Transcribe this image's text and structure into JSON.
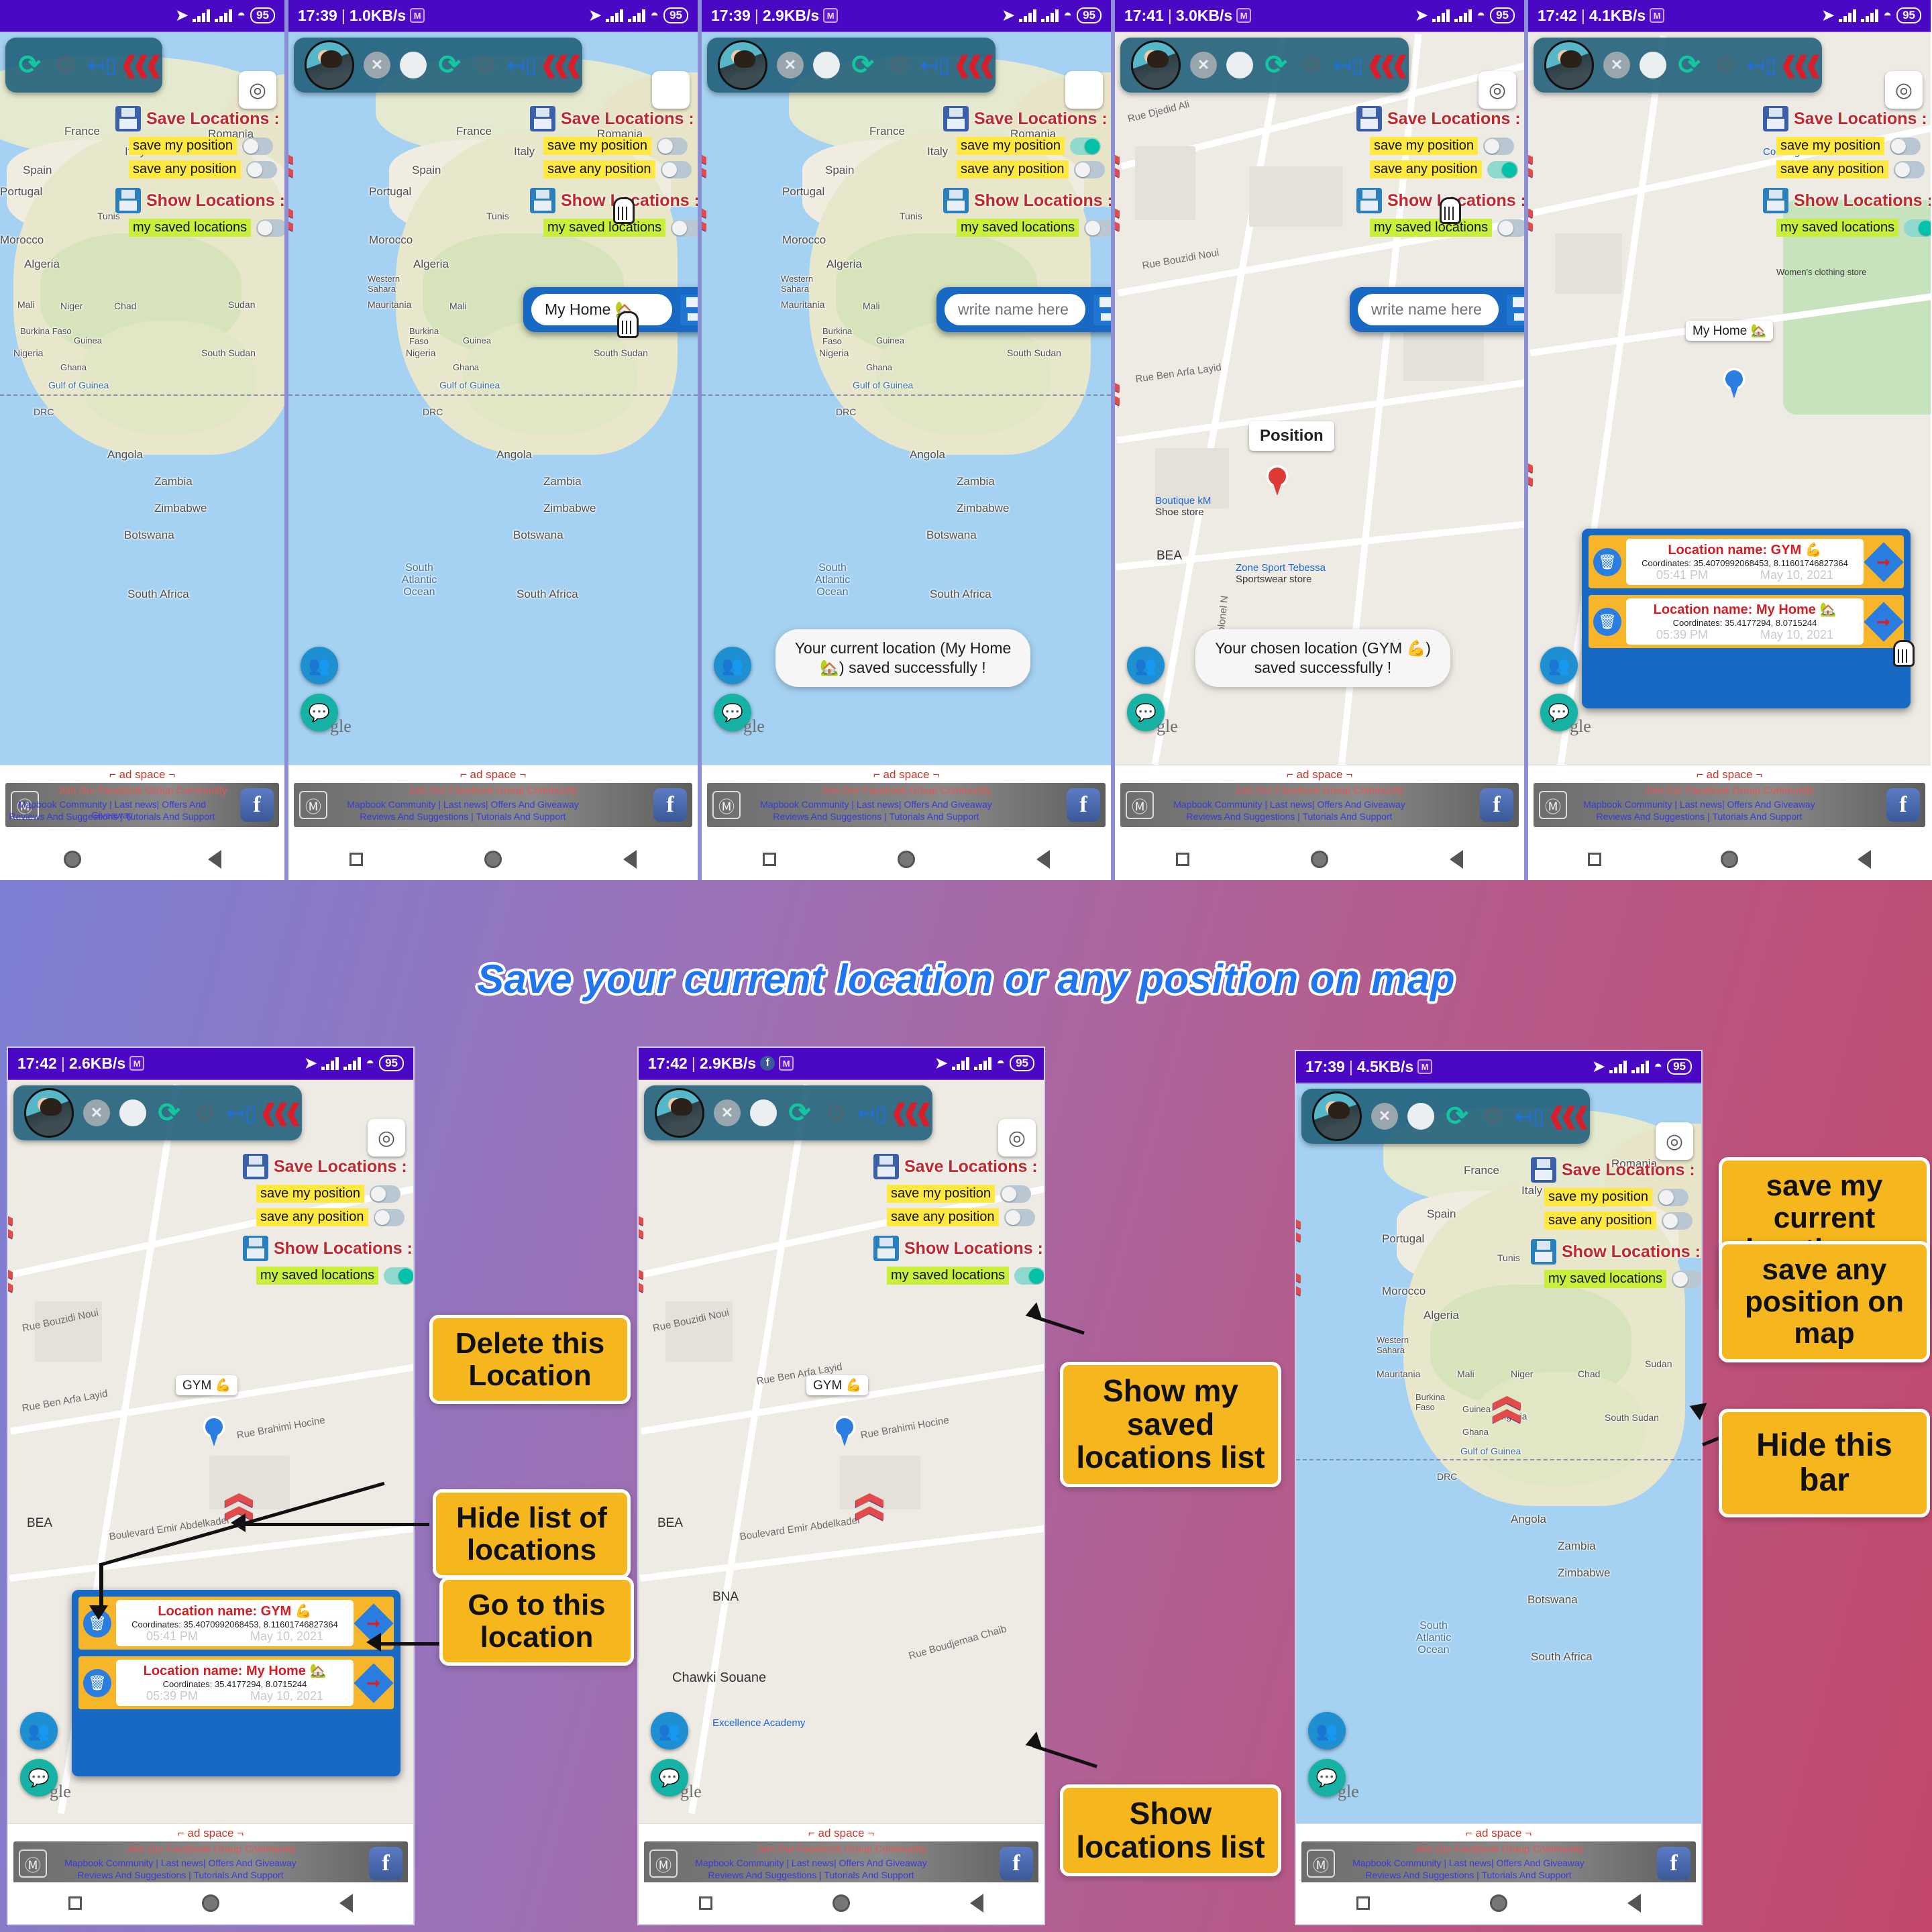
{
  "app": {
    "headline": "Save your current location or any position on map",
    "save_locations_label": "Save Locations :",
    "show_locations_label": "Show Locations :",
    "save_my_position": "save my position",
    "save_any_position": "save any position",
    "my_saved_locations": "my saved locations",
    "name_placeholder": "write name here",
    "name_value_my_home": "My Home 🏡",
    "gym_pin_label": "GYM 💪",
    "home_pin_label": "My Home 🏡",
    "position_pin_label": "Position"
  },
  "statusbars": [
    {
      "time": "",
      "speed": "",
      "battery": "95"
    },
    {
      "time": "17:39",
      "speed": "1.0KB/s",
      "battery": "95"
    },
    {
      "time": "17:39",
      "speed": "2.9KB/s",
      "battery": "95"
    },
    {
      "time": "17:41",
      "speed": "3.0KB/s",
      "battery": "95"
    },
    {
      "time": "17:42",
      "speed": "4.1KB/s",
      "battery": "95"
    },
    {
      "time": "17:42",
      "speed": "2.6KB/s",
      "battery": "95"
    },
    {
      "time": "17:42",
      "speed": "2.9KB/s",
      "battery": "95"
    },
    {
      "time": "17:39",
      "speed": "4.5KB/s",
      "battery": "95"
    }
  ],
  "toasts": {
    "current_saved": "Your current location (My Home 🏡) saved successfully !",
    "chosen_saved": "Your chosen location (GYM 💪) saved successfully !"
  },
  "saved_locations": [
    {
      "name": "Location name: GYM 💪",
      "coordinates": "Coordinates: 35.4070992068453, 8.11601746827364",
      "time": "05:41 PM",
      "date": "May 10, 2021"
    },
    {
      "name": "Location name: My Home 🏡",
      "coordinates": "Coordinates: 35.4177294, 8.0715244",
      "time": "05:39 PM",
      "date": "May 10, 2021"
    }
  ],
  "callouts": {
    "delete": "Delete this Location",
    "hide_list": "Hide list of locations",
    "go_to": "Go to this location",
    "show_my_saved": "Show my saved locations list",
    "show_list": "Show locations list",
    "save_current": "save my current location on map",
    "save_any": "save any position on map",
    "hide_bar": "Hide this bar"
  },
  "ad": {
    "ad_space": "⌐ ad space ¬",
    "line1": "Join Our Facebook Group Community",
    "line2": "Mapbook Community | Last news| Offers And Giveaway",
    "line3": "Reviews And Suggestions | Tutorials And Support",
    "facebook_icon": "f",
    "mapbook_icon": "Ⓜ"
  },
  "world_map_labels": [
    "France",
    "Romania",
    "Italy",
    "Spain",
    "Portugal",
    "Tunis",
    "Morocco",
    "Algeria",
    "Western Sahara",
    "Mauritania",
    "Mali",
    "Niger",
    "Chad",
    "Sudan",
    "Burkina Faso",
    "Guinea",
    "Nigeria",
    "Ghana",
    "South Sudan",
    "Gulf of Guinea",
    "Gabon",
    "DRC",
    "Angola",
    "Zambia",
    "Zimbabwe",
    "Botswana",
    "South Africa",
    "South Atlantic Ocean"
  ],
  "street_map_labels": [
    "Rue Djedid Ali",
    "Rue Bouzidi Noui",
    "Rue Ben Arfa Layid",
    "Rue Colonel N",
    "Rue Brahimi Hocine",
    "Boulevard Emir Abdelkader",
    "Rue Boudjemaa Chaib",
    "Chawki Souane",
    "Academy",
    "BEA",
    "BNA"
  ],
  "street_pois": [
    {
      "title": "Boutique kM",
      "sub": "Shoe store"
    },
    {
      "title": "Zone Sport Tebessa",
      "sub": "Sportswear store"
    },
    {
      "title": "Cooking and Food",
      "sub": ""
    },
    {
      "title": "Women's clothing store",
      "sub": ""
    },
    {
      "title": "Excellence Academy",
      "sub": ""
    }
  ],
  "icons": {
    "refresh": "refresh-icon",
    "gear": "gear-icon",
    "exit": "exit-icon",
    "chevrons": "double-chevron-icon",
    "gps": "gps-target-icon",
    "close": "close-icon",
    "floppy": "floppy-save-icon",
    "trash": "trash-icon",
    "navigate": "navigate-arrow-icon",
    "people": "people-icon",
    "chat": "chat-icon"
  },
  "colors": {
    "statusbar": "#4B08C4",
    "accent_red": "#c0282d",
    "chip_yellow": "#ffe93f",
    "chip_green": "#c9ef3a",
    "dialog_blue": "#1769c4",
    "callout_yellow": "#f5b71d",
    "toggle_on": "#00c2a8"
  },
  "google_watermark": "gle"
}
